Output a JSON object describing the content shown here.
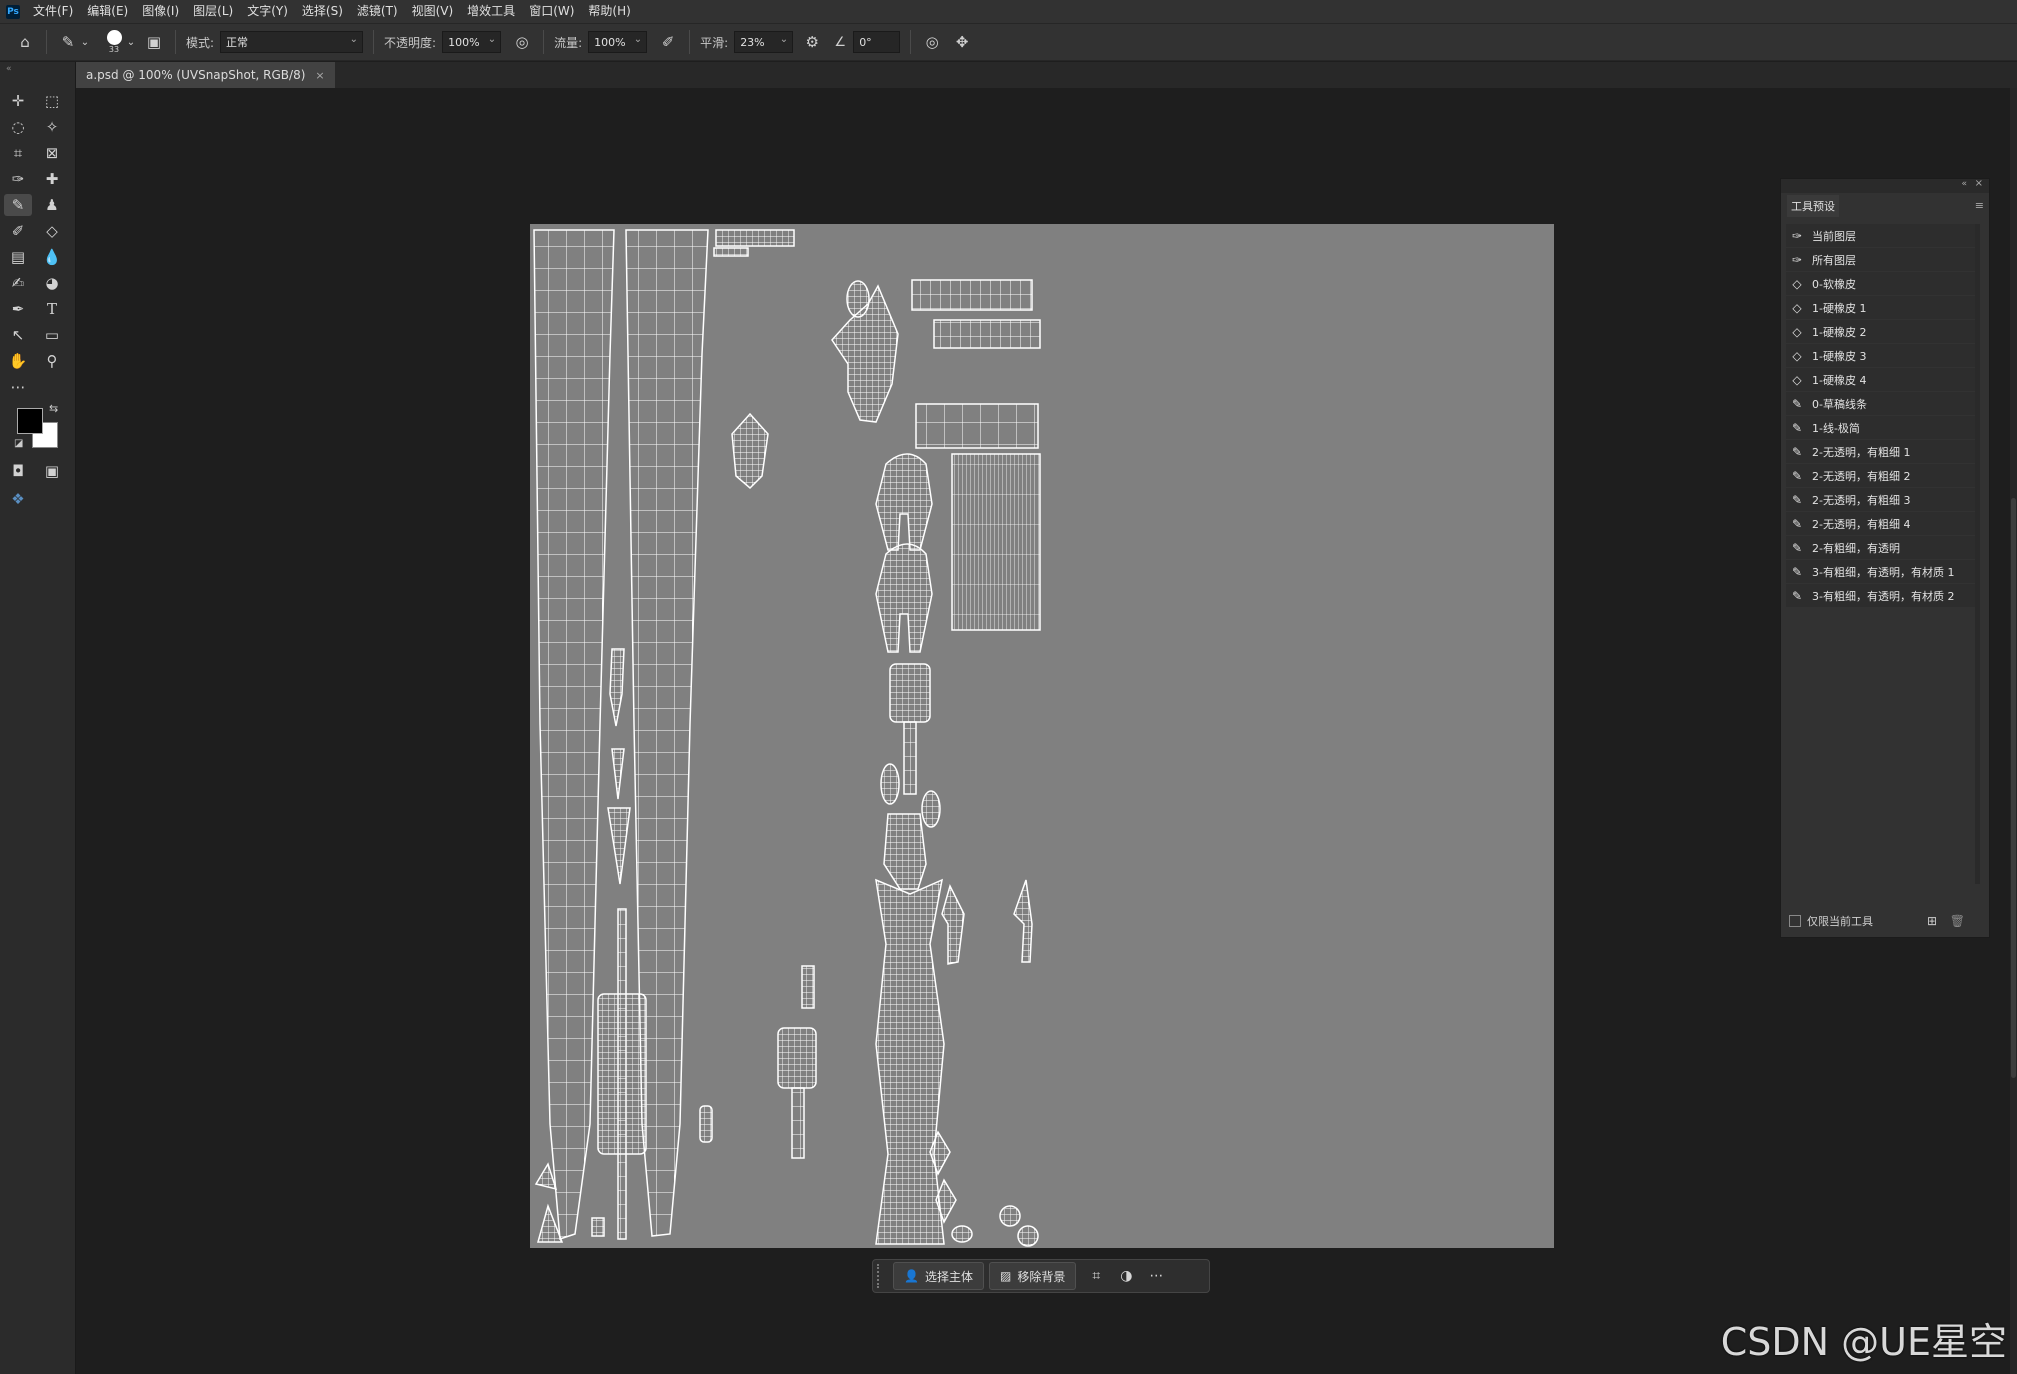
{
  "app": {
    "logo": "Ps"
  },
  "menu": [
    "文件(F)",
    "编辑(E)",
    "图像(I)",
    "图层(L)",
    "文字(Y)",
    "选择(S)",
    "滤镜(T)",
    "视图(V)",
    "增效工具",
    "窗口(W)",
    "帮助(H)"
  ],
  "options": {
    "brush_size": "33",
    "mode_label": "模式:",
    "mode_value": "正常",
    "opacity_label": "不透明度:",
    "opacity_value": "100%",
    "flow_label": "流量:",
    "flow_value": "100%",
    "smooth_label": "平滑:",
    "smooth_value": "23%",
    "angle_value": "0°"
  },
  "document_tab": {
    "title": "a.psd @ 100% (UVSnapShot, RGB/8)"
  },
  "canvas": {
    "background": "#808080",
    "wire_color": "#ffffff",
    "content": "UV snapshot wireframe"
  },
  "context_bar": {
    "select_subject": "选择主体",
    "remove_background": "移除背景"
  },
  "tool_presets_panel": {
    "title": "工具预设",
    "items": [
      {
        "label": "当前图层",
        "icon": "dropper-icon"
      },
      {
        "label": "所有图层",
        "icon": "dropper-icon"
      },
      {
        "label": "0-软橡皮",
        "icon": "eraser-icon"
      },
      {
        "label": "1-硬橡皮 1",
        "icon": "eraser-icon"
      },
      {
        "label": "1-硬橡皮 2",
        "icon": "eraser-icon"
      },
      {
        "label": "1-硬橡皮 3",
        "icon": "eraser-icon"
      },
      {
        "label": "1-硬橡皮 4",
        "icon": "eraser-icon"
      },
      {
        "label": "0-草稿线条",
        "icon": "brush-icon"
      },
      {
        "label": "1-线-极简",
        "icon": "brush-icon"
      },
      {
        "label": "2-无透明，有粗细 1",
        "icon": "brush-icon"
      },
      {
        "label": "2-无透明，有粗细 2",
        "icon": "brush-icon"
      },
      {
        "label": "2-无透明，有粗细 3",
        "icon": "brush-icon"
      },
      {
        "label": "2-无透明，有粗细 4",
        "icon": "brush-icon"
      },
      {
        "label": "2-有粗细，有透明",
        "icon": "brush-icon"
      },
      {
        "label": "3-有粗细，有透明，有材质 1",
        "icon": "brush-icon"
      },
      {
        "label": "3-有粗细，有透明，有材质 2",
        "icon": "brush-icon"
      }
    ],
    "footer_checkbox": "仅限当前工具"
  },
  "watermark": "CSDN @UE星空"
}
